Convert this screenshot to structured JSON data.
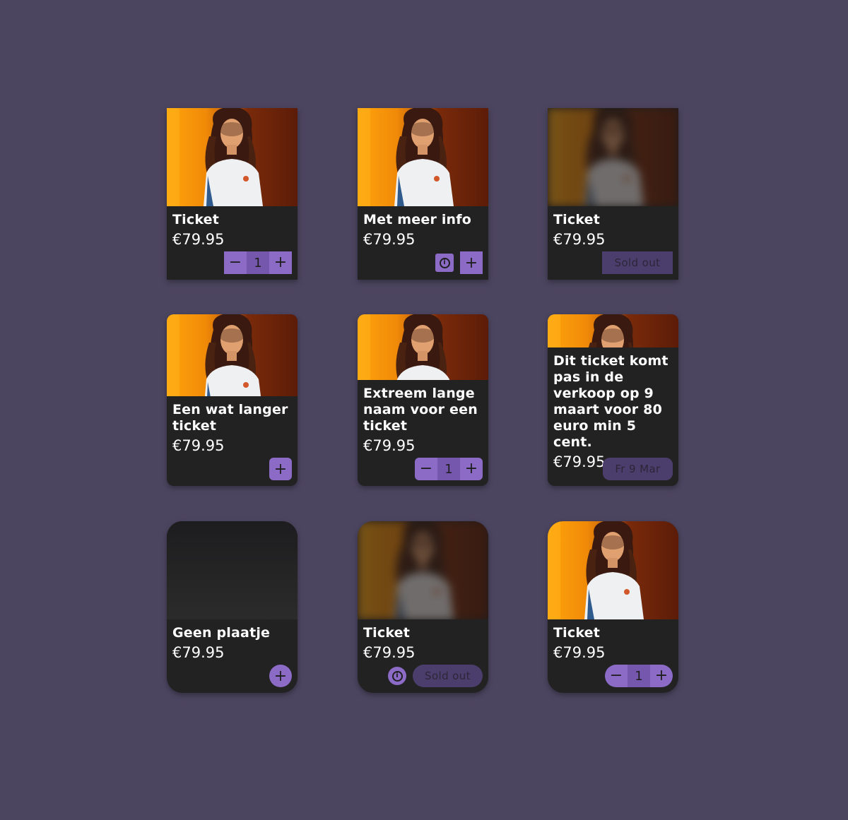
{
  "cards": [
    {
      "name": "Ticket",
      "price": "€79.95",
      "quantity": "1",
      "minus": "−",
      "plus": "+"
    },
    {
      "name": "Met meer info",
      "price": "€79.95",
      "info": "i",
      "plus": "+"
    },
    {
      "name": "Ticket",
      "price": "€79.95",
      "status": "Sold out"
    },
    {
      "name": "Een wat langer ticket",
      "price": "€79.95",
      "plus": "+"
    },
    {
      "name": "Extreem lange naam voor een ticket",
      "price": "€79.95",
      "quantity": "1",
      "minus": "−",
      "plus": "+"
    },
    {
      "name": "Dit ticket komt pas in de verkoop op 9 maart voor 80 euro min 5 cent.",
      "price": "€79.95",
      "status": "Fr 9 Mar"
    },
    {
      "name": "Geen plaatje",
      "price": "€79.95",
      "plus": "+"
    },
    {
      "name": "Ticket",
      "price": "€79.95",
      "info": "i",
      "status": "Sold out"
    },
    {
      "name": "Ticket",
      "price": "€79.95",
      "quantity": "1",
      "minus": "−",
      "plus": "+"
    }
  ],
  "colors": {
    "background": "#4c4560",
    "card": "#222222",
    "accent": "#8b6bc6",
    "accent_dark": "#7557ad",
    "disabled": "#4c3e6c"
  },
  "icons": {
    "info": "info-circle-icon",
    "plus": "plus-icon",
    "minus": "minus-icon"
  }
}
